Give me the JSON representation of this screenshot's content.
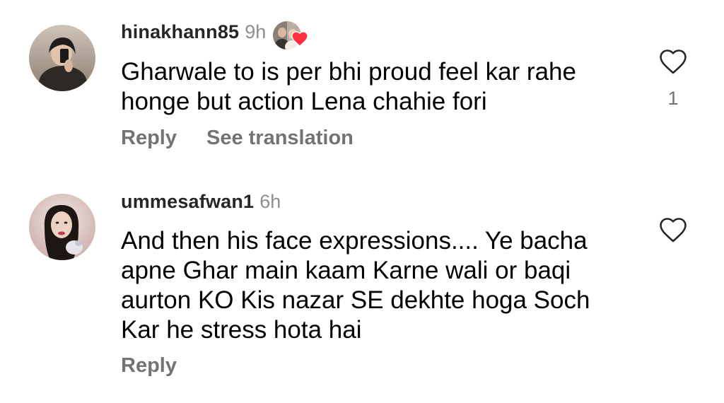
{
  "comments": [
    {
      "username": "hinakhann85",
      "time": "9h",
      "text": "Gharwale to is per bhi proud feel kar rahe honge but action Lena chahie fori",
      "actions": [
        "Reply",
        "See translation"
      ],
      "like_count": "1",
      "liked_by_creator": true,
      "icons": {
        "avatar": "avatar",
        "like": "heart-outline-icon",
        "badge": "heart-filled-icon"
      }
    },
    {
      "username": "ummesafwan1",
      "time": "6h",
      "text": "And then his face expressions.... Ye bacha apne Ghar main kaam Karne wali or baqi aurton KO Kis nazar SE dekhte hoga Soch Kar he stress hota hai",
      "actions": [
        "Reply"
      ],
      "like_count": "",
      "icons": {
        "avatar": "avatar",
        "like": "heart-outline-icon"
      }
    }
  ],
  "colors": {
    "badge_heart": "#ff3040",
    "secondary_text": "#737373",
    "username": "#262626"
  }
}
